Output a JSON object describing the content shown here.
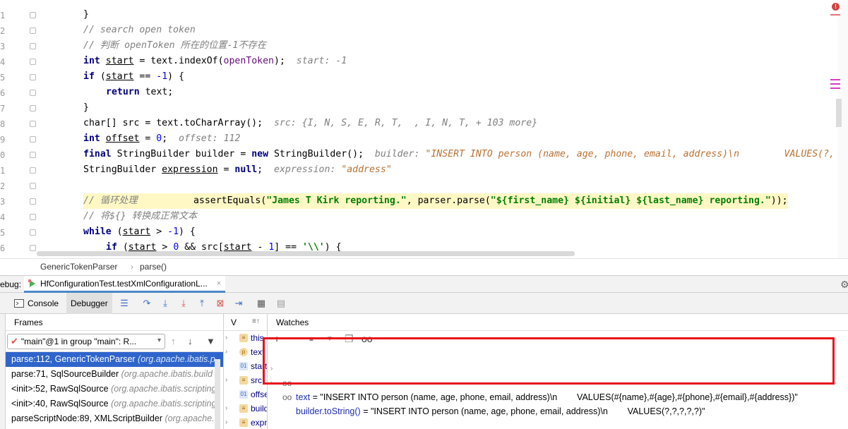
{
  "editor": {
    "gutter_lines": [
      "1",
      "2",
      "3",
      "4",
      "5",
      "6",
      "7",
      "8",
      "9",
      "0",
      "1",
      "2",
      "3",
      "4",
      "5",
      "6"
    ],
    "code": {
      "l0_brace": "}",
      "l1_comment": "// search open token",
      "l2_comment": "// 判断 openToken 所在的位置-1不存在",
      "l3_type": "int",
      "l3_var": "start",
      "l3_rest": " = text.indexOf(",
      "l3_arg": "openToken",
      "l3_end": ");",
      "l3_hint": "start: -1",
      "l4_kw": "if",
      "l4_pre": " (",
      "l4_var": "start",
      "l4_op": " == ",
      "l4_num": "-1",
      "l4_end": ") {",
      "l5_kw": "return",
      "l5_rest": " text;",
      "l6_brace": "}",
      "l7_code": "char[] src = text.toCharArray();",
      "l7_hint": "src: {I, N, S, E, R, T,  , I, N, T, + 103 more}",
      "l8_type": "int",
      "l8_var": "offset",
      "l8_op": " = ",
      "l8_num": "0",
      "l8_end": ";",
      "l8_hint": "offset: 112",
      "l9_kw": "final",
      "l9_mid": " StringBuilder builder = ",
      "l9_kw2": "new",
      "l9_end": " StringBuilder();",
      "l9_hint_label": "builder:",
      "l9_hint_val": "\"INSERT INTO person (name, age, phone, email, address)\\n        VALUES(?,",
      "l10_pre": "StringBuilder ",
      "l10_var": "expression",
      "l10_op": " = ",
      "l10_kw": "null",
      "l10_end": ";",
      "l10_hint_label": "expression:",
      "l10_hint_val": "\"address\"",
      "l12_comment": "// 循环处理",
      "l12_tail_pre": "assertEquals(",
      "l12_tail_s1": "\"James T Kirk reporting.\"",
      "l12_tail_mid": ", parser.parse(",
      "l12_tail_s2": "\"${first_name} ${initial} ${last_name} reporting.\"",
      "l12_tail_end": "));",
      "l13_comment": "// 将${} 转换成正常文本",
      "l14_kw": "while",
      "l14_pre": " (",
      "l14_var": "start",
      "l14_op": " > ",
      "l14_num": "-1",
      "l14_end": ") {",
      "l15_kw": "if",
      "l15_pre": " (",
      "l15_var": "start",
      "l15_op": " > ",
      "l15_num": "0",
      "l15_mid": " && src[",
      "l15_var2": "start",
      "l15_op2": " - ",
      "l15_num2": "1",
      "l15_mid2": "] == ",
      "l15_str": "'\\\\'",
      "l15_end": ") {"
    },
    "error_badge": "!"
  },
  "breadcrumb": {
    "class": "GenericTokenParser",
    "sep": "›",
    "method": "parse()"
  },
  "debug": {
    "label": "ebug:",
    "session_tab": "HfConfigurationTest.testXmlConfigurationL...",
    "close": "×",
    "tabs": {
      "console": "Console",
      "debugger": "Debugger"
    }
  },
  "frames": {
    "title": "Frames",
    "thread": "\"main\"@1 in group \"main\": R...",
    "items": [
      {
        "method": "parse:112, GenericTokenParser",
        "pkg": "(org.apache.ibatis.p"
      },
      {
        "method": "parse:71, SqlSourceBuilder",
        "pkg": "(org.apache.ibatis.build"
      },
      {
        "method": "<init>:52, RawSqlSource",
        "pkg": "(org.apache.ibatis.scripting"
      },
      {
        "method": "<init>:40, RawSqlSource",
        "pkg": "(org.apache.ibatis.scripting"
      },
      {
        "method": "parseScriptNode:89, XMLScriptBuilder",
        "pkg": "(org.apache."
      }
    ]
  },
  "variables": {
    "title": "V",
    "menu": "≡↑",
    "items": [
      {
        "name": "this",
        "icon": "≡",
        "icon_color": "#e0a030"
      },
      {
        "name": "text",
        "icon": "p",
        "icon_color": "#e0a030"
      },
      {
        "name": "start",
        "icon": "01",
        "icon_color": "#3d6fc4"
      },
      {
        "name": "src",
        "icon": "≡",
        "icon_color": "#e0a030"
      },
      {
        "name": "offset",
        "icon": "01",
        "icon_color": "#3d6fc4"
      },
      {
        "name": "builder",
        "icon": "≡",
        "icon_color": "#e0a030"
      },
      {
        "name": "expression",
        "icon": "≡",
        "icon_color": "#e0a030"
      }
    ]
  },
  "watches": {
    "title": "Watches",
    "items": [
      {
        "expr": "text",
        "value": " = \"INSERT INTO person (name, age, phone, email, address)\\n        VALUES(#{name},#{age},#{phone},#{email},#{address})\""
      },
      {
        "expr": "builder.toString()",
        "value": " = \"INSERT INTO person (name, age, phone, email, address)\\n        VALUES(?,?,?,?,?)\""
      }
    ]
  },
  "colors": {
    "accent": "#2f65ca",
    "highlight_box": "#e8101a"
  }
}
